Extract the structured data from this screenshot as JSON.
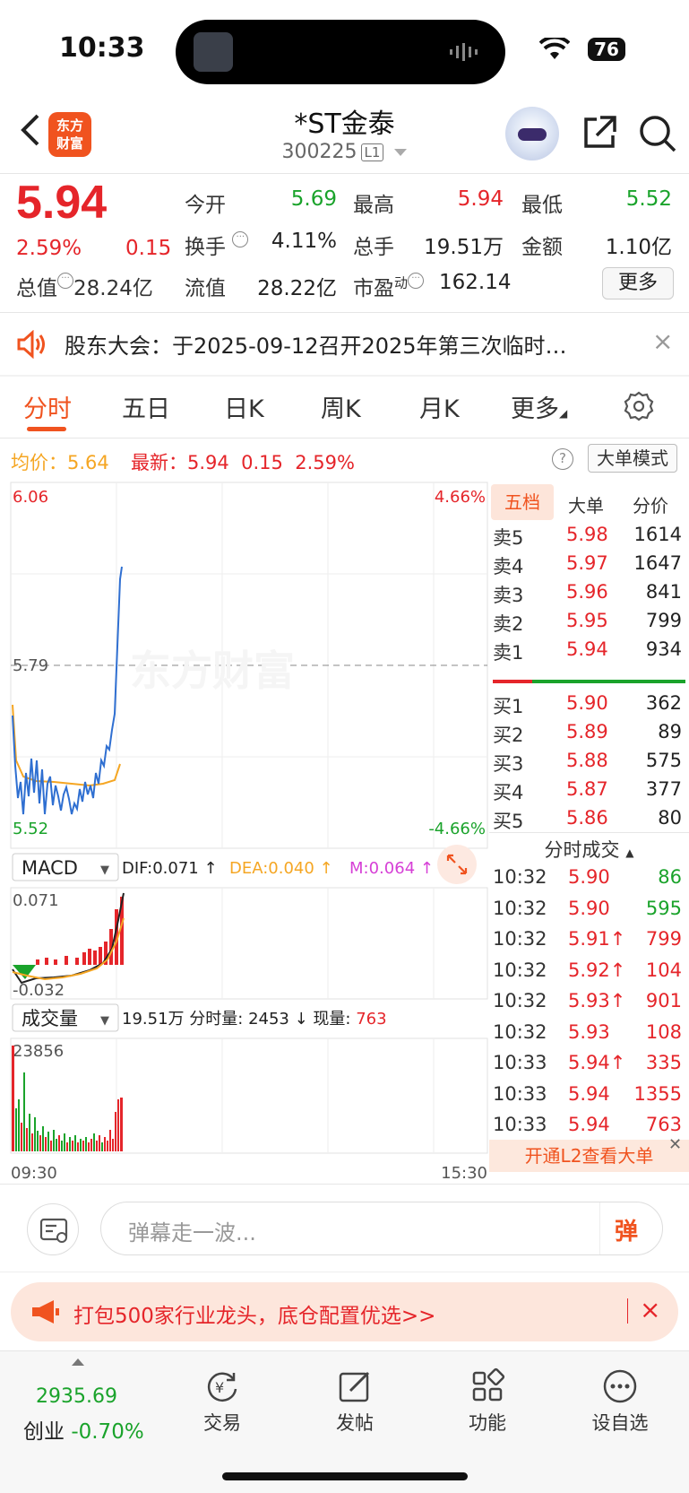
{
  "status_bar": {
    "time": "10:33",
    "battery": "76"
  },
  "nav": {
    "logo_line1": "东方",
    "logo_line2": "财富",
    "stock_name": "*ST金泰",
    "stock_code": "300225",
    "level_badge": "L1"
  },
  "quote": {
    "price": "5.94",
    "change_pct": "2.59%",
    "change": "0.15",
    "open_label": "今开",
    "open": "5.69",
    "high_label": "最高",
    "high": "5.94",
    "low_label": "最低",
    "low": "5.52",
    "turnover_label": "换手",
    "turnover": "4.11%",
    "volume_label": "总手",
    "volume": "19.51万",
    "amount_label": "金额",
    "amount": "1.10亿",
    "mktcap_label": "总值",
    "mktcap": "28.24亿",
    "float_label": "流值",
    "float_cap": "28.22亿",
    "pe_label": "市盈",
    "pe_sup": "动",
    "pe": "162.14",
    "more_label": "更多"
  },
  "notice": {
    "text": "股东大会：于2025-09-12召开2025年第三次临时…"
  },
  "tabs": [
    "分时",
    "五日",
    "日K",
    "周K",
    "月K",
    "更多"
  ],
  "chart_head": {
    "avg_label": "均价：",
    "avg": "5.64",
    "latest_label": "最新：",
    "latest": "5.94",
    "latest_chg": "0.15",
    "latest_pct": "2.59%",
    "mode_btn": "大单模式"
  },
  "chart_labels": {
    "top_price": "6.06",
    "mid_price": "5.79",
    "bottom_price": "5.52",
    "top_pct": "4.66%",
    "bottom_pct": "-4.66%",
    "watermark": "东方财富",
    "start_time": "09:30",
    "end_time": "15:30"
  },
  "macd": {
    "select": "MACD",
    "dif_label": "DIF:",
    "dif": "0.071",
    "dea_label": "DEA:",
    "dea": "0.040",
    "m_label": "M:",
    "m": "0.064",
    "top": "0.071",
    "bottom": "-0.032"
  },
  "volume_panel": {
    "select": "成交量",
    "total": "19.51万",
    "minute_label": "分时量:",
    "minute": "2453",
    "now_label": "现量:",
    "now": "763",
    "max": "23856"
  },
  "book": {
    "tabs": [
      "五档",
      "大单",
      "分价"
    ],
    "asks": [
      {
        "label": "卖5",
        "price": "5.98",
        "vol": "1614"
      },
      {
        "label": "卖4",
        "price": "5.97",
        "vol": "1647"
      },
      {
        "label": "卖3",
        "price": "5.96",
        "vol": "841"
      },
      {
        "label": "卖2",
        "price": "5.95",
        "vol": "799"
      },
      {
        "label": "卖1",
        "price": "5.94",
        "vol": "934"
      }
    ],
    "bids": [
      {
        "label": "买1",
        "price": "5.90",
        "vol": "362"
      },
      {
        "label": "买2",
        "price": "5.89",
        "vol": "89"
      },
      {
        "label": "买3",
        "price": "5.88",
        "vol": "575"
      },
      {
        "label": "买4",
        "price": "5.87",
        "vol": "377"
      },
      {
        "label": "买5",
        "price": "5.86",
        "vol": "80"
      }
    ],
    "tick_header": "分时成交",
    "ticks": [
      {
        "time": "10:32",
        "price": "5.90",
        "vol": "86",
        "color": "#1aa32b"
      },
      {
        "time": "10:32",
        "price": "5.90",
        "vol": "595",
        "color": "#1aa32b"
      },
      {
        "time": "10:32",
        "price": "5.91↑",
        "vol": "799",
        "color": "#e5252a"
      },
      {
        "time": "10:32",
        "price": "5.92↑",
        "vol": "104",
        "color": "#e5252a"
      },
      {
        "time": "10:32",
        "price": "5.93↑",
        "vol": "901",
        "color": "#e5252a"
      },
      {
        "time": "10:32",
        "price": "5.93",
        "vol": "108",
        "color": "#e5252a"
      },
      {
        "time": "10:33",
        "price": "5.94↑",
        "vol": "335",
        "color": "#e5252a"
      },
      {
        "time": "10:33",
        "price": "5.94",
        "vol": "1355",
        "color": "#e5252a"
      },
      {
        "time": "10:33",
        "price": "5.94",
        "vol": "763",
        "color": "#e5252a"
      }
    ],
    "l2_banner": "开通L2查看大单"
  },
  "danmaku": {
    "placeholder": "弹幕走一波...",
    "send": "弹"
  },
  "ad": {
    "text": "打包500家行业龙头，底仓配置优选>>"
  },
  "bottom": {
    "index_value": "2935.69",
    "index_name": "创业",
    "index_pct": "-0.70%",
    "items": [
      "交易",
      "发帖",
      "功能",
      "设自选"
    ]
  }
}
